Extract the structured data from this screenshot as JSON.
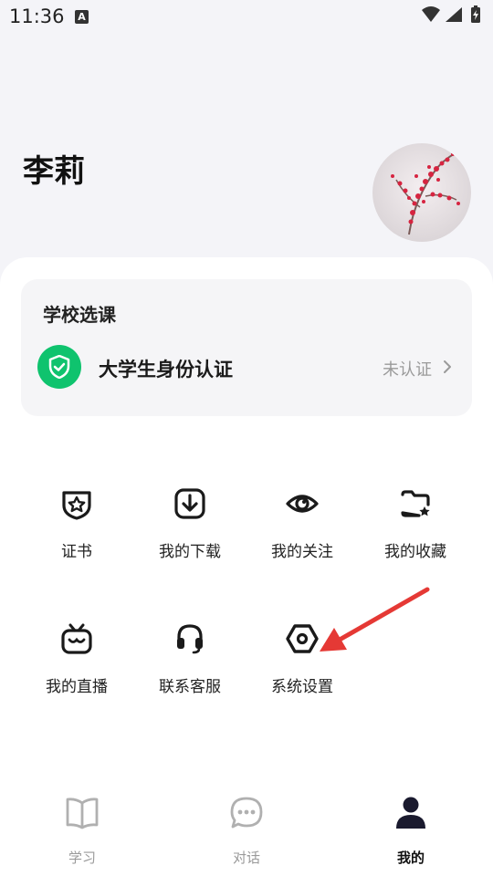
{
  "status_bar": {
    "time": "11:36",
    "notification_icon": "A"
  },
  "profile": {
    "name": "李莉"
  },
  "school_card": {
    "title": "学校选课",
    "verify_label": "大学生身份认证",
    "verify_status": "未认证"
  },
  "grid": [
    {
      "label": "证书",
      "icon": "certificate-icon"
    },
    {
      "label": "我的下载",
      "icon": "download-icon"
    },
    {
      "label": "我的关注",
      "icon": "eye-icon"
    },
    {
      "label": "我的收藏",
      "icon": "favorites-folder-icon"
    },
    {
      "label": "我的直播",
      "icon": "tv-icon"
    },
    {
      "label": "联系客服",
      "icon": "headset-icon"
    },
    {
      "label": "系统设置",
      "icon": "settings-hexagon-icon"
    }
  ],
  "bottom_nav": [
    {
      "label": "学习",
      "icon": "book-icon",
      "active": false
    },
    {
      "label": "对话",
      "icon": "chat-icon",
      "active": false
    },
    {
      "label": "我的",
      "icon": "person-icon",
      "active": true
    }
  ],
  "colors": {
    "verify_green": "#0fc36e",
    "annotation_red": "#e53935",
    "inactive_gray": "#9a9a9a"
  }
}
